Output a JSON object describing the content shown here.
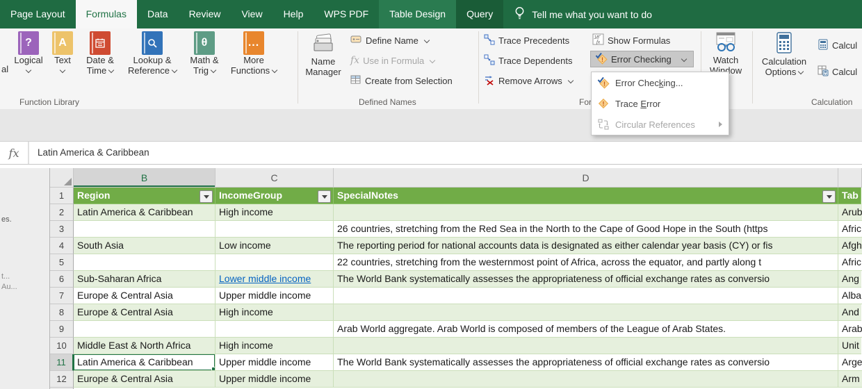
{
  "colors": {
    "excel_green": "#217346",
    "tab_bar": "#1F6B42",
    "contextual_tab_light": "#2A7B50",
    "contextual_tab_dark": "#1A5C37",
    "table_header_green": "#71AC47",
    "banded_row_green": "#E6F0DD",
    "hyperlink_blue": "#0563C1",
    "pressed_button_gray": "#C8C8C8",
    "warning_diamond": "#F9CE8B",
    "warning_mark": "#C55A11",
    "check_blue": "#2E5FA3"
  },
  "tabbar": {
    "tabs": [
      "Page Layout",
      "Formulas",
      "Data",
      "Review",
      "View",
      "Help",
      "WPS PDF",
      "Table Design",
      "Query"
    ],
    "tell_me": "Tell me what you want to do"
  },
  "ribbon": {
    "clipped_label_left": "al",
    "function_library": {
      "label": "Function Library",
      "buttons": [
        {
          "line1": "Logical",
          "symbol": "?",
          "color": "#9C64BB"
        },
        {
          "line1": "Text",
          "symbol": "A",
          "color": "#EDC36A"
        },
        {
          "line1": "Date &",
          "line2": "Time",
          "color": "#CF4B32"
        },
        {
          "line1": "Lookup &",
          "line2": "Reference",
          "color": "#3273B9"
        },
        {
          "line1": "Math &",
          "line2": "Trig",
          "symbol": "θ",
          "color": "#5E9C85"
        },
        {
          "line1": "More",
          "line2": "Functions",
          "symbol": "...",
          "color": "#E8862D"
        }
      ]
    },
    "defined_names": {
      "label": "Defined Names",
      "name_manager_line1": "Name",
      "name_manager_line2": "Manager",
      "define_name": "Define Name",
      "use_in_formula": "Use in Formula",
      "create_from_selection": "Create from Selection"
    },
    "formula_auditing": {
      "trace_precedents": "Trace Precedents",
      "trace_dependents": "Trace Dependents",
      "remove_arrows": "Remove Arrows",
      "show_formulas": "Show Formulas",
      "error_checking": "Error Checking",
      "label_clipped": "For"
    },
    "watch_window": {
      "line1": "Watch",
      "line2": "Window"
    },
    "calculation": {
      "label": "Calculation",
      "options_line1": "Calculation",
      "options_line2": "Options",
      "calc_now_clipped": "Calcul",
      "calc_sheet_clipped": "Calcul"
    }
  },
  "menu": {
    "items": [
      {
        "pre": "Error Chec",
        "key": "k",
        "post": "ing..."
      },
      {
        "pre": "Trace ",
        "key": "E",
        "post": "rror"
      },
      {
        "label": "Circular References"
      }
    ]
  },
  "formula_bar": {
    "fx": "fx",
    "value": "Latin America & Caribbean"
  },
  "grid": {
    "left_fragments": [
      "es.",
      "t...",
      "Au..."
    ],
    "col_letters": {
      "b": "B",
      "c": "C",
      "d": "D"
    },
    "header": {
      "n": "1",
      "region": "Region",
      "income": "IncomeGroup",
      "notes": "SpecialNotes",
      "table": "Tab"
    },
    "rows": [
      {
        "n": "2",
        "b": "Latin America & Caribbean",
        "c": "High income",
        "d": "",
        "e": "Arub"
      },
      {
        "n": "3",
        "b": "",
        "c": "",
        "d": "26 countries, stretching from the Red Sea in the North to the Cape of Good Hope in the South (https",
        "e": "Afric"
      },
      {
        "n": "4",
        "b": "South Asia",
        "c": "Low income",
        "d": "The reporting period for national accounts data is designated as either calendar year basis (CY) or fis",
        "e": "Afgh"
      },
      {
        "n": "5",
        "b": "",
        "c": "",
        "d": "22 countries, stretching from the westernmost point of Africa, across the equator, and partly along t",
        "e": "Afric"
      },
      {
        "n": "6",
        "b": "Sub-Saharan Africa",
        "c": "Lower middle income",
        "d": "The World Bank systematically assesses the appropriateness of official exchange rates as conversio",
        "e": "Ang"
      },
      {
        "n": "7",
        "b": "Europe & Central Asia",
        "c": "Upper middle income",
        "d": "",
        "e": "Alba"
      },
      {
        "n": "8",
        "b": "Europe & Central Asia",
        "c": "High income",
        "d": "",
        "e": "And"
      },
      {
        "n": "9",
        "b": "",
        "c": "",
        "d": "Arab World aggregate. Arab World is composed of members of the League of Arab States.",
        "e": "Arab"
      },
      {
        "n": "10",
        "b": "Middle East & North Africa",
        "c": "High income",
        "d": "",
        "e": "Unit"
      },
      {
        "n": "11",
        "b": "Latin America & Caribbean",
        "c": "Upper middle income",
        "d": "The World Bank systematically assesses the appropriateness of official exchange rates as conversio",
        "e": "Arge"
      },
      {
        "n": "12",
        "b": "Europe & Central Asia",
        "c": "Upper middle income",
        "d": "",
        "e": "Arm"
      }
    ]
  }
}
